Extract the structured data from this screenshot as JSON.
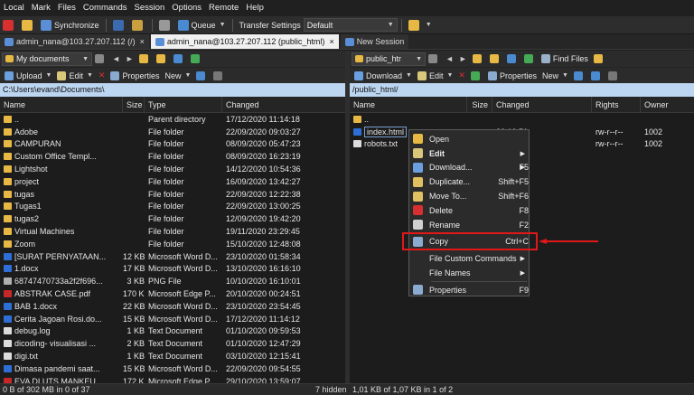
{
  "menubar": [
    "Local",
    "Mark",
    "Files",
    "Commands",
    "Session",
    "Options",
    "Remote",
    "Help"
  ],
  "toolbar": {
    "synchronize": "Synchronize",
    "queue": "Queue",
    "transfer_settings_label": "Transfer Settings",
    "transfer_settings_value": "Default"
  },
  "tabs": [
    {
      "label": "admin_nana@103.27.207.112 (/)",
      "close": "×"
    },
    {
      "label": "admin_nana@103.27.207.112 (public_html)",
      "close": "×"
    },
    {
      "label": "New Session"
    }
  ],
  "left": {
    "location": "My documents",
    "upload": "Upload",
    "edit": "Edit",
    "properties": "Properties",
    "new": "New",
    "path": "C:\\Users\\evand\\Documents\\",
    "columns": {
      "name": "Name",
      "size": "Size",
      "type": "Type",
      "changed": "Changed"
    },
    "rows": [
      {
        "name": "..",
        "size": "",
        "type": "Parent directory",
        "changed": "17/12/2020 11:14:18",
        "icon": "updir"
      },
      {
        "name": "Adobe",
        "size": "",
        "type": "File folder",
        "changed": "22/09/2020 09:03:27",
        "icon": "folder"
      },
      {
        "name": "CAMPURAN",
        "size": "",
        "type": "File folder",
        "changed": "08/09/2020 05:47:23",
        "icon": "folder"
      },
      {
        "name": "Custom Office Templ...",
        "size": "",
        "type": "File folder",
        "changed": "08/09/2020 16:23:19",
        "icon": "folder"
      },
      {
        "name": "Lightshot",
        "size": "",
        "type": "File folder",
        "changed": "14/12/2020 10:54:36",
        "icon": "folder"
      },
      {
        "name": "project",
        "size": "",
        "type": "File folder",
        "changed": "16/09/2020 13:42:27",
        "icon": "folder"
      },
      {
        "name": "tugas",
        "size": "",
        "type": "File folder",
        "changed": "22/09/2020 12:22:38",
        "icon": "folder"
      },
      {
        "name": "Tugas1",
        "size": "",
        "type": "File folder",
        "changed": "22/09/2020 13:00:25",
        "icon": "folder"
      },
      {
        "name": "tugas2",
        "size": "",
        "type": "File folder",
        "changed": "12/09/2020 19:42:20",
        "icon": "folder"
      },
      {
        "name": "Virtual Machines",
        "size": "",
        "type": "File folder",
        "changed": "19/11/2020 23:29:45",
        "icon": "folder"
      },
      {
        "name": "Zoom",
        "size": "",
        "type": "File folder",
        "changed": "15/10/2020 12:48:08",
        "icon": "folder"
      },
      {
        "name": "[SURAT PERNYATAAN...",
        "size": "12 KB",
        "type": "Microsoft Word D...",
        "changed": "23/10/2020 01:58:34",
        "icon": "doc"
      },
      {
        "name": "1.docx",
        "size": "17 KB",
        "type": "Microsoft Word D...",
        "changed": "13/10/2020 16:16:10",
        "icon": "doc"
      },
      {
        "name": "68747470733a2f2f696...",
        "size": "3 KB",
        "type": "PNG File",
        "changed": "10/10/2020 16:10:01",
        "icon": "png"
      },
      {
        "name": "ABSTRAK CASE.pdf",
        "size": "170 KB",
        "type": "Microsoft Edge P...",
        "changed": "20/10/2020 00:24:51",
        "icon": "pdf"
      },
      {
        "name": "BAB 1.docx",
        "size": "22 KB",
        "type": "Microsoft Word D...",
        "changed": "23/10/2020 23:54:45",
        "icon": "doc"
      },
      {
        "name": "Cerita Jagoan Rosi.do...",
        "size": "15 KB",
        "type": "Microsoft Word D...",
        "changed": "17/12/2020 11:14:12",
        "icon": "doc"
      },
      {
        "name": "debug.log",
        "size": "1 KB",
        "type": "Text Document",
        "changed": "01/10/2020 09:59:53",
        "icon": "txt"
      },
      {
        "name": "dicoding- visualisasi ...",
        "size": "2 KB",
        "type": "Text Document",
        "changed": "01/10/2020 12:47:29",
        "icon": "txt"
      },
      {
        "name": "digi.txt",
        "size": "1 KB",
        "type": "Text Document",
        "changed": "03/10/2020 12:15:41",
        "icon": "txt"
      },
      {
        "name": "Dimasa pandemi saat...",
        "size": "15 KB",
        "type": "Microsoft Word D...",
        "changed": "22/09/2020 09:54:55",
        "icon": "doc"
      },
      {
        "name": "EVA DI UTS MANKEU",
        "size": "172 KB",
        "type": "Microsoft Edge P...",
        "changed": "29/10/2020 13:59:07",
        "icon": "pdf"
      }
    ]
  },
  "right": {
    "location": "public_htr",
    "find_files": "Find Files",
    "download": "Download",
    "edit": "Edit",
    "properties": "Properties",
    "new": "New",
    "path": "/public_html/",
    "columns": {
      "name": "Name",
      "size": "Size",
      "changed": "Changed",
      "rights": "Rights",
      "owner": "Owner"
    },
    "rows": [
      {
        "name": "..",
        "size": "",
        "changed": "",
        "rights": "",
        "owner": "",
        "icon": "updir"
      },
      {
        "name": "index.html",
        "size": "",
        "changed": "20 10:51",
        "rights": "rw-r--r--",
        "owner": "1002",
        "icon": "doc"
      },
      {
        "name": "robots.txt",
        "size": "",
        "changed": "20 10:51",
        "rights": "rw-r--r--",
        "owner": "1002",
        "icon": "txt"
      }
    ]
  },
  "context_menu": [
    {
      "label": "Open",
      "key": "",
      "icon_color": "#e8b844"
    },
    {
      "label": "Edit",
      "key": "",
      "submenu": true,
      "bold": true,
      "icon_color": "#d9c77a"
    },
    {
      "label": "Download...",
      "key": "F5",
      "submenu": true,
      "icon_color": "#6aa0e0"
    },
    {
      "label": "Duplicate...",
      "key": "Shift+F5",
      "icon_color": "#e0c060"
    },
    {
      "label": "Move To...",
      "key": "Shift+F6",
      "icon_color": "#e0c060"
    },
    {
      "label": "Delete",
      "key": "F8",
      "icon_color": "#d83030"
    },
    {
      "label": "Rename",
      "key": "F2",
      "icon_color": "#d0d0d0"
    },
    {
      "sep": true
    },
    {
      "label": "Copy",
      "key": "Ctrl+C",
      "icon_color": "#8aaad0"
    },
    {
      "sep": true
    },
    {
      "label": "File Custom Commands",
      "key": "",
      "submenu": true
    },
    {
      "label": "File Names",
      "key": "",
      "submenu": true
    },
    {
      "sep": true
    },
    {
      "label": "Properties",
      "key": "F9",
      "icon_color": "#8aaad0"
    }
  ],
  "status": {
    "left": "0 B of 302 MB in 0 of 37",
    "hidden": "7 hidden",
    "right": "1,01 KB of 1,07 KB in 1 of 2"
  },
  "colors": {
    "highlight": "#e01818",
    "path_bg": "#bcd5f0",
    "accent": "#2d6fd6"
  }
}
